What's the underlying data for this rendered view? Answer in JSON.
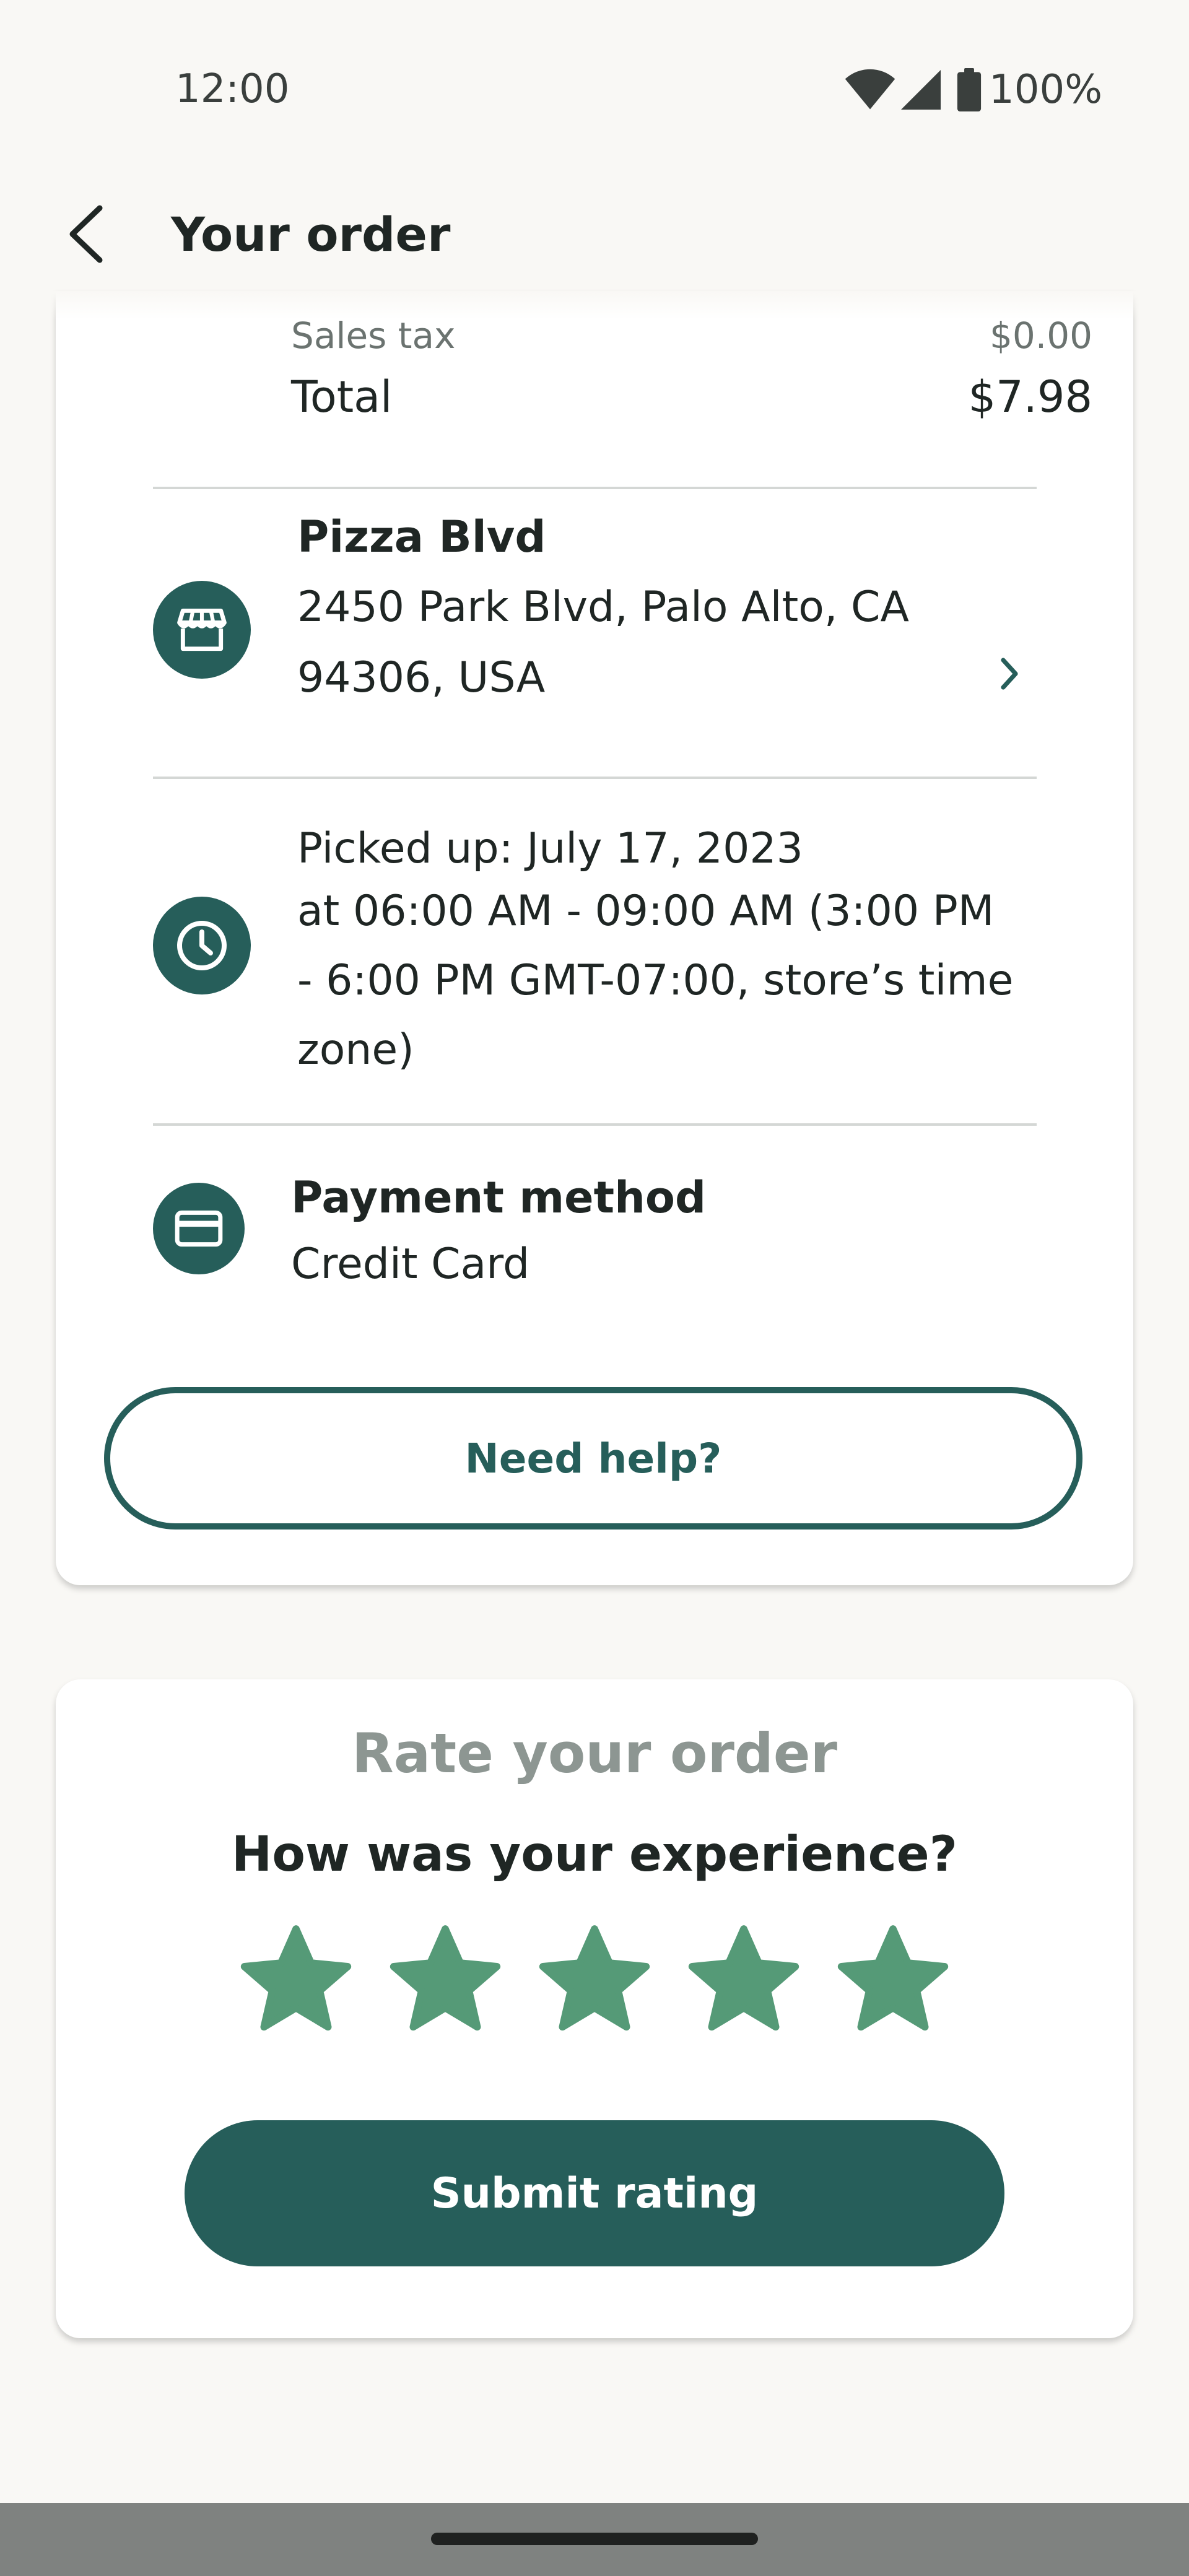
{
  "status_bar": {
    "time": "12:00",
    "battery": "100%",
    "icons": [
      "wifi-icon",
      "cellular-signal-icon",
      "battery-icon"
    ]
  },
  "header": {
    "title": "Your order",
    "back_icon": "arrow-back-icon"
  },
  "order": {
    "sales_tax_label": "Sales tax",
    "sales_tax_value": "$0.00",
    "total_label": "Total",
    "total_value": "$7.98",
    "store": {
      "icon": "storefront-icon",
      "name": "Pizza Blvd",
      "address_line1": "2450 Park Blvd, Palo Alto, CA",
      "address_line2": "94306, USA"
    },
    "pickup": {
      "icon": "clock-icon",
      "line1": "Picked up: July 17, 2023",
      "line2": "at 06:00 AM - 09:00 AM (3:00 PM",
      "line3": "- 6:00 PM GMT-07:00, store’s time",
      "line4": "zone)"
    },
    "payment": {
      "icon": "credit-card-icon",
      "label": "Payment method",
      "value": "Credit Card"
    },
    "help_button": "Need help?"
  },
  "rating": {
    "title": "Rate your order",
    "question": "How was your experience?",
    "stars_total": 5,
    "stars_selected": 5,
    "submit_button": "Submit rating"
  },
  "colors": {
    "brand": "#265e5a",
    "star": "#559a77",
    "background": "#f9f8f5",
    "muted_title": "#8d9692"
  }
}
